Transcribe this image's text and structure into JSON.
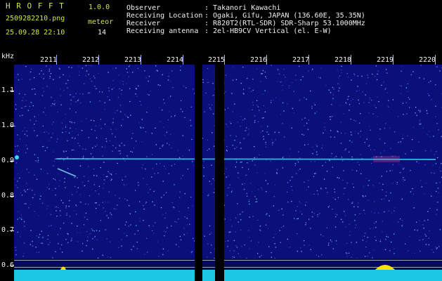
{
  "header": {
    "app_name": "H R O F F T",
    "version": "1.0.0",
    "filename": "2509282210.png",
    "datetime": "25.09.28 22:10",
    "meteor_label": "meteor",
    "meteor_count": "14",
    "info": [
      {
        "label": "Observer",
        "value": ": Takanori Kawachi"
      },
      {
        "label": "Receiving Location",
        "value": ": Ogaki, Gifu, JAPAN (136.60E, 35.35N)"
      },
      {
        "label": "Receiver",
        "value": ": R820T2(RTL-SDR) SDR-Sharp 53.1000MHz"
      },
      {
        "label": "Receiving antenna",
        "value": ": 2el-HB9CV Vertical (el. E-W)"
      }
    ]
  },
  "axes": {
    "y_unit": "kHz",
    "y_ticks": [
      "1.1",
      "1.0",
      "0.9",
      "0.8",
      "0.7",
      "0.6"
    ],
    "x_ticks": [
      "2211",
      "2212",
      "2213",
      "2214",
      "2215",
      "2216",
      "2217",
      "2218",
      "2219",
      "2220"
    ]
  },
  "colors": {
    "background": "#0b0f7a",
    "signal": "#38d9e8",
    "header_accent": "#cde84b",
    "header_text": "#f2f2f2"
  }
}
